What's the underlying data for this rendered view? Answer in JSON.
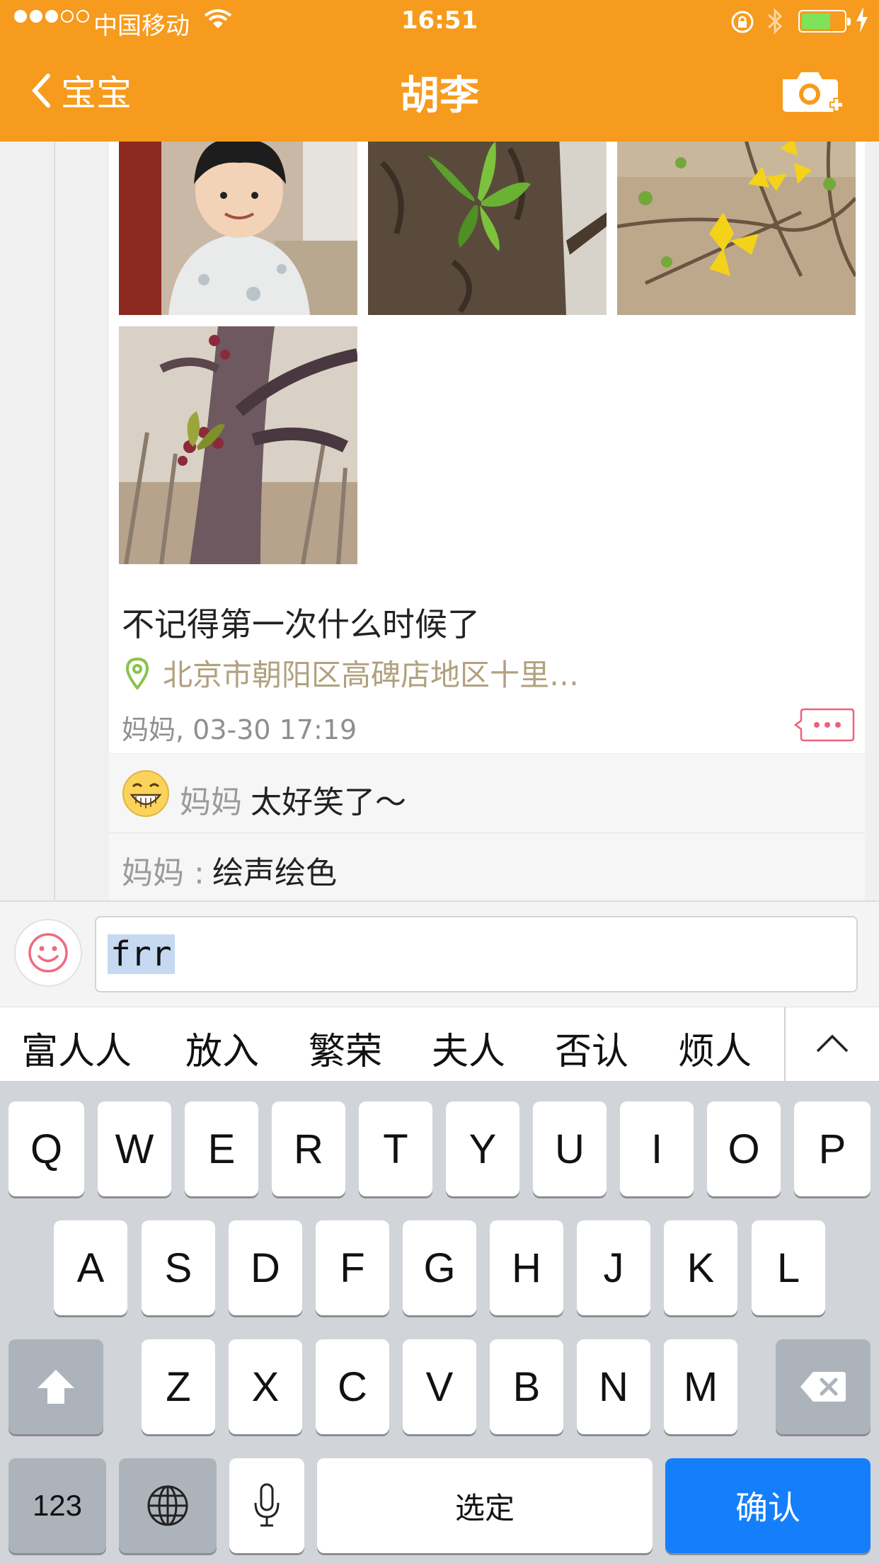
{
  "status_bar": {
    "carrier": "中国移动",
    "time": "16:51",
    "signal_bars_filled": 3,
    "signal_bars_total": 5,
    "battery_level": 0.6
  },
  "nav": {
    "back_label": "宝宝",
    "title": "胡李",
    "camera_icon": "camera-add-icon"
  },
  "post": {
    "text": "不记得第一次什么时候了",
    "location": "北京市朝阳区高碑店地区十里…",
    "meta": "妈妈, 03-30 17:19",
    "photos": [
      "child-photo",
      "tree-bud-photo",
      "yellow-flowers-photo",
      "red-buds-photo"
    ]
  },
  "likes": {
    "who": "妈妈",
    "text": "太好笑了～"
  },
  "comment": {
    "who": "妈妈 :",
    "text": "绘声绘色"
  },
  "input": {
    "value": "frr"
  },
  "candidates": [
    "富人人",
    "放入",
    "繁荣",
    "夫人",
    "否认",
    "烦人"
  ],
  "keyboard": {
    "row1": [
      "Q",
      "W",
      "E",
      "R",
      "T",
      "Y",
      "U",
      "I",
      "O",
      "P"
    ],
    "row2": [
      "A",
      "S",
      "D",
      "F",
      "G",
      "H",
      "J",
      "K",
      "L"
    ],
    "row3": [
      "Z",
      "X",
      "C",
      "V",
      "B",
      "N",
      "M"
    ],
    "numbers_label": "123",
    "space_label": "选定",
    "confirm_label": "确认"
  },
  "colors": {
    "brand_orange": "#f69b1e",
    "confirm_blue": "#147efb",
    "location_green": "#8bc34a",
    "more_pink": "#f0607a"
  }
}
